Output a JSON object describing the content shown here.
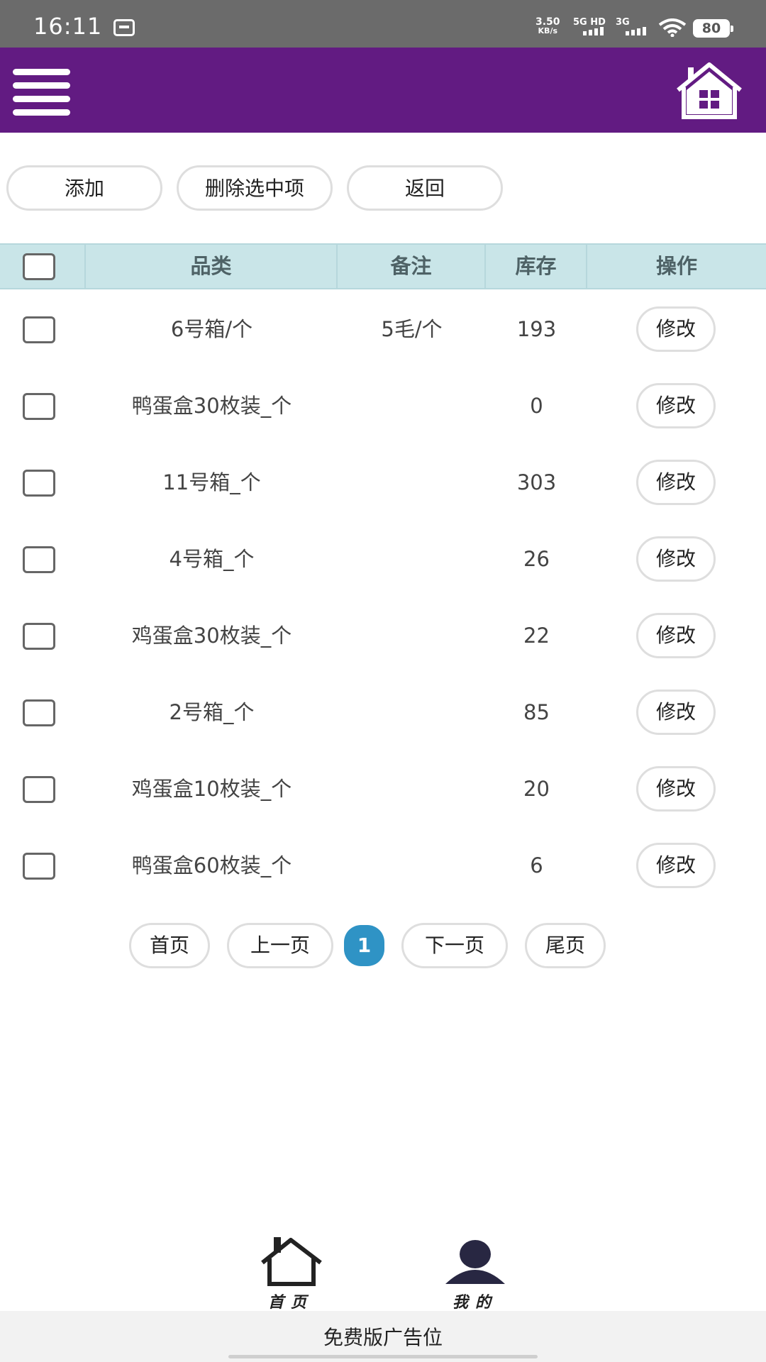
{
  "status_bar": {
    "time": "16:11",
    "speed_value": "3.50",
    "speed_unit": "KB/s",
    "net1": "5G HD",
    "net2": "3G",
    "battery": "80"
  },
  "app_bar": {
    "menu_icon": "hamburger-menu-icon",
    "home_icon": "house-icon",
    "accent_color": "#621b82"
  },
  "toolbar": {
    "add_label": "添加",
    "delete_label": "删除选中项",
    "back_label": "返回"
  },
  "table": {
    "headers": {
      "category": "品类",
      "note": "备注",
      "stock": "库存",
      "action": "操作"
    },
    "edit_label": "修改",
    "rows": [
      {
        "category": "6号箱/个",
        "note": "5毛/个",
        "stock": "193"
      },
      {
        "category": "鸭蛋盒30枚装_个",
        "note": "",
        "stock": "0"
      },
      {
        "category": "11号箱_个",
        "note": "",
        "stock": "303"
      },
      {
        "category": "4号箱_个",
        "note": "",
        "stock": "26"
      },
      {
        "category": "鸡蛋盒30枚装_个",
        "note": "",
        "stock": "22"
      },
      {
        "category": "2号箱_个",
        "note": "",
        "stock": "85"
      },
      {
        "category": "鸡蛋盒10枚装_个",
        "note": "",
        "stock": "20"
      },
      {
        "category": "鸭蛋盒60枚装_个",
        "note": "",
        "stock": "6"
      }
    ]
  },
  "pagination": {
    "first": "首页",
    "prev": "上一页",
    "current": "1",
    "next": "下一页",
    "last": "尾页",
    "current_color": "#2f93c5"
  },
  "bottom_nav": {
    "home_label": "首页",
    "mine_label": "我的"
  },
  "ad": {
    "text": "免费版广告位"
  }
}
